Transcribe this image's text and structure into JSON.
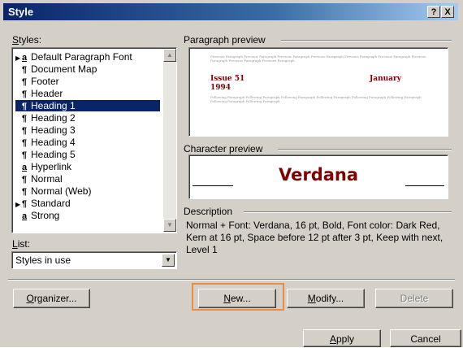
{
  "window": {
    "title": "Style",
    "help_button": "?",
    "close_button": "X"
  },
  "styles_panel": {
    "label_u": "S",
    "label_rest": "tyles:",
    "items": [
      {
        "glyph": "a",
        "label": "Default Paragraph Font",
        "marker": "▶",
        "selected": false
      },
      {
        "glyph": "¶",
        "label": "Document Map",
        "marker": "",
        "selected": false
      },
      {
        "glyph": "¶",
        "label": "Footer",
        "marker": "",
        "selected": false
      },
      {
        "glyph": "¶",
        "label": "Header",
        "marker": "",
        "selected": false
      },
      {
        "glyph": "¶",
        "label": "Heading 1",
        "marker": "",
        "selected": true
      },
      {
        "glyph": "¶",
        "label": "Heading 2",
        "marker": "",
        "selected": false
      },
      {
        "glyph": "¶",
        "label": "Heading 3",
        "marker": "",
        "selected": false
      },
      {
        "glyph": "¶",
        "label": "Heading 4",
        "marker": "",
        "selected": false
      },
      {
        "glyph": "¶",
        "label": "Heading 5",
        "marker": "",
        "selected": false
      },
      {
        "glyph": "a",
        "label": "Hyperlink",
        "marker": "",
        "selected": false
      },
      {
        "glyph": "¶",
        "label": "Normal",
        "marker": "",
        "selected": false
      },
      {
        "glyph": "¶",
        "label": "Normal (Web)",
        "marker": "",
        "selected": false
      },
      {
        "glyph": "¶",
        "label": "Standard",
        "marker": "▶",
        "selected": false
      },
      {
        "glyph": "a",
        "label": "Strong",
        "marker": "",
        "selected": false
      }
    ]
  },
  "list_panel": {
    "label_u": "L",
    "label_rest": "ist:",
    "selected": "Styles in use"
  },
  "paragraph_preview": {
    "label": "Paragraph preview",
    "prev_text": "Previous Paragraph Previous Paragraph Previous Paragraph Previous Paragraph Previous Paragraph Previous Paragraph Previous Paragraph Previous Paragraph Previous Paragraph",
    "heading_left": "Issue 51",
    "heading_right": "January",
    "heading_year": "1994",
    "follow_text": "Following Paragraph Following Paragraph Following Paragraph Following Paragraph Following Paragraph Following Paragraph Following Paragraph Following Paragraph"
  },
  "character_preview": {
    "label": "Character preview",
    "sample": "Verdana"
  },
  "description": {
    "label": "Description",
    "text": "Normal + Font: Verdana, 16 pt, Bold, Font color: Dark Red, Kern at 16 pt, Space before 12 pt  after 3 pt, Keep with next, Level 1"
  },
  "buttons": {
    "organizer_u": "O",
    "organizer_rest": "rganizer...",
    "new_u": "N",
    "new_rest": "ew...",
    "modify_u": "M",
    "modify_rest": "odify...",
    "delete": "Delete",
    "apply_u": "A",
    "apply_rest": "pply",
    "cancel": "Cancel"
  },
  "colors": {
    "highlight": "#0a246a",
    "dark_red": "#800000",
    "focus_box": "#f08c3c"
  }
}
